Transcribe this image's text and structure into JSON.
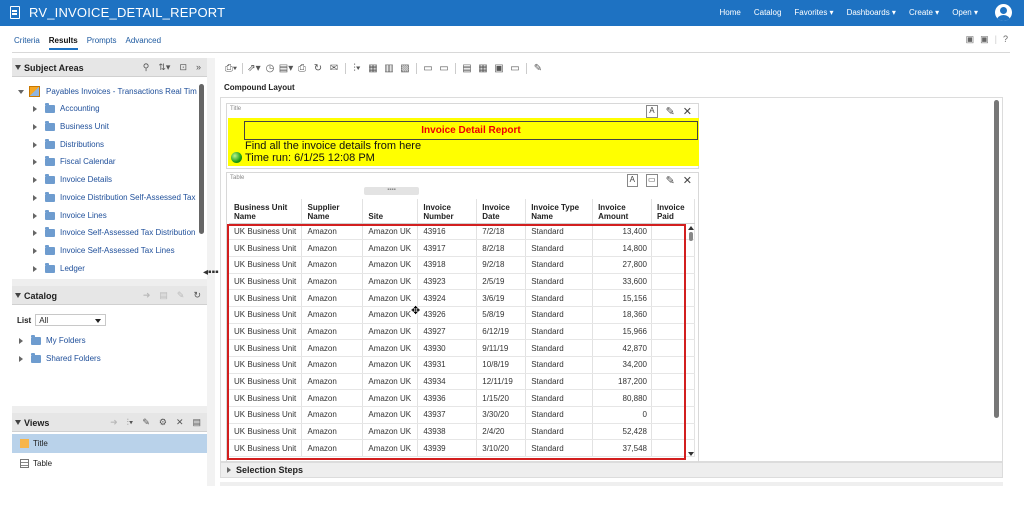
{
  "app": {
    "title": "RV_INVOICE_DETAIL_REPORT",
    "nav": [
      "Home",
      "Catalog",
      "Favorites ▾",
      "Dashboards ▾",
      "Create ▾",
      "Open ▾"
    ]
  },
  "tabs": [
    {
      "label": "Criteria",
      "active": false
    },
    {
      "label": "Results",
      "active": true
    },
    {
      "label": "Prompts",
      "active": false
    },
    {
      "label": "Advanced",
      "active": false
    }
  ],
  "subject_areas": {
    "title": "Subject Areas",
    "root": "Payables Invoices - Transactions Real Tim",
    "items": [
      "Accounting",
      "Business Unit",
      "Distributions",
      "Fiscal Calendar",
      "Invoice Details",
      "Invoice Distribution Self-Assessed Tax",
      "Invoice Lines",
      "Invoice Self-Assessed Tax Distribution",
      "Invoice Self-Assessed Tax Lines",
      "Ledger"
    ]
  },
  "catalog": {
    "title": "Catalog",
    "list_label": "List",
    "list_value": "All",
    "folders": [
      "My Folders",
      "Shared Folders"
    ]
  },
  "views": {
    "title": "Views",
    "items": [
      "Title",
      "Table"
    ]
  },
  "editor": {
    "compound_label": "Compound Layout",
    "title_view_label": "Title",
    "table_view_label": "Table",
    "report_title": "Invoice Detail Report",
    "subtitle": "Find all the invoice details from here",
    "time_run": "Time run: 6/1/25 12:08 PM",
    "selection_steps": "Selection Steps"
  },
  "table": {
    "headers": [
      "Business Unit Name",
      "Supplier Name",
      "Site",
      "Invoice Number",
      "Invoice Date",
      "Invoice Type Name",
      "Invoice Amount",
      "Invoice Paid"
    ],
    "rows": [
      [
        "UK Business Unit",
        "Amazon",
        "Amazon UK",
        "43916",
        "7/2/18",
        "Standard",
        "13,400",
        ""
      ],
      [
        "UK Business Unit",
        "Amazon",
        "Amazon UK",
        "43917",
        "8/2/18",
        "Standard",
        "14,800",
        ""
      ],
      [
        "UK Business Unit",
        "Amazon",
        "Amazon UK",
        "43918",
        "9/2/18",
        "Standard",
        "27,800",
        ""
      ],
      [
        "UK Business Unit",
        "Amazon",
        "Amazon UK",
        "43923",
        "2/5/19",
        "Standard",
        "33,600",
        ""
      ],
      [
        "UK Business Unit",
        "Amazon",
        "Amazon UK",
        "43924",
        "3/6/19",
        "Standard",
        "15,156",
        ""
      ],
      [
        "UK Business Unit",
        "Amazon",
        "Amazon UK",
        "43926",
        "5/8/19",
        "Standard",
        "18,360",
        ""
      ],
      [
        "UK Business Unit",
        "Amazon",
        "Amazon UK",
        "43927",
        "6/12/19",
        "Standard",
        "15,966",
        ""
      ],
      [
        "UK Business Unit",
        "Amazon",
        "Amazon UK",
        "43930",
        "9/11/19",
        "Standard",
        "42,870",
        ""
      ],
      [
        "UK Business Unit",
        "Amazon",
        "Amazon UK",
        "43931",
        "10/8/19",
        "Standard",
        "34,200",
        ""
      ],
      [
        "UK Business Unit",
        "Amazon",
        "Amazon UK",
        "43934",
        "12/11/19",
        "Standard",
        "187,200",
        ""
      ],
      [
        "UK Business Unit",
        "Amazon",
        "Amazon UK",
        "43936",
        "1/15/20",
        "Standard",
        "80,880",
        ""
      ],
      [
        "UK Business Unit",
        "Amazon",
        "Amazon UK",
        "43937",
        "3/30/20",
        "Standard",
        "0",
        ""
      ],
      [
        "UK Business Unit",
        "Amazon",
        "Amazon UK",
        "43938",
        "2/4/20",
        "Standard",
        "52,428",
        ""
      ],
      [
        "UK Business Unit",
        "Amazon",
        "Amazon UK",
        "43939",
        "3/10/20",
        "Standard",
        "37,548",
        ""
      ]
    ]
  },
  "colors": {
    "topbar": "#1e72c2",
    "title_band": "#ffff00",
    "report_title": "#ee0000",
    "highlight_box": "#d21f1f"
  }
}
